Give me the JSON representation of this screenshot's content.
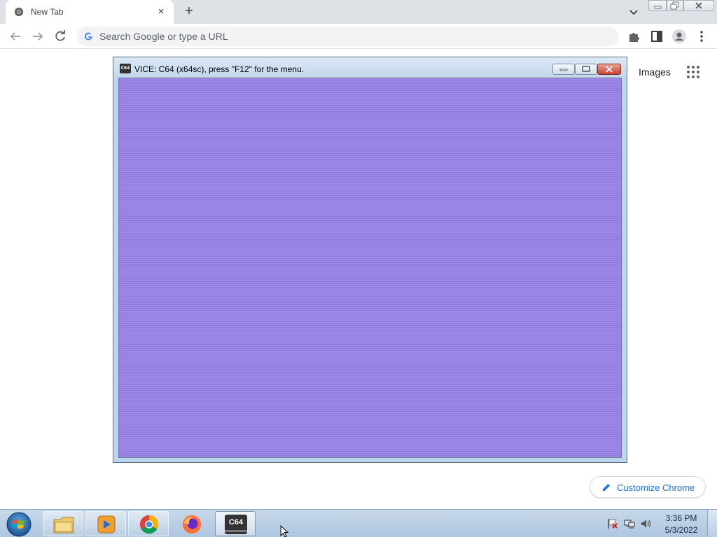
{
  "browser": {
    "tab": {
      "title": "New Tab",
      "close_glyph": "×",
      "favicon": "chrome-icon"
    },
    "new_tab_glyph": "+",
    "omnibox": {
      "placeholder": "Search Google or type a URL"
    },
    "nav": {
      "back": "arrow-left-icon",
      "forward": "arrow-right-icon",
      "reload": "reload-icon"
    },
    "toolbar_icons": [
      "puzzle-icon",
      "side-panel-icon",
      "profile-icon",
      "more-vert-icon"
    ]
  },
  "ntp": {
    "images_link": "Images",
    "apps_icon": "apps-grid-icon",
    "customize_label": "Customize Chrome"
  },
  "vice_window": {
    "title": "VICE: C64 (x64sc), press \"F12\" for the menu.",
    "icon_text": "C64",
    "screen_color": "#9b84e6"
  },
  "taskbar": {
    "apps": [
      {
        "name": "Windows Explorer",
        "icon": "folder-icon"
      },
      {
        "name": "Windows Media Player",
        "icon": "media-player-icon"
      },
      {
        "name": "Google Chrome",
        "icon": "chrome-icon"
      },
      {
        "name": "Firefox",
        "icon": "firefox-icon"
      },
      {
        "name": "C64",
        "icon": "c64-icon",
        "label": "C64"
      }
    ],
    "clock": {
      "time": "3:36 PM",
      "date": "5/3/2022"
    },
    "tray": [
      "flag-icon",
      "network-icon",
      "volume-icon"
    ]
  },
  "colors": {
    "taskbar": "#aec6df",
    "accent": "#1a73e8",
    "vice_screen": "#9b84e6"
  }
}
